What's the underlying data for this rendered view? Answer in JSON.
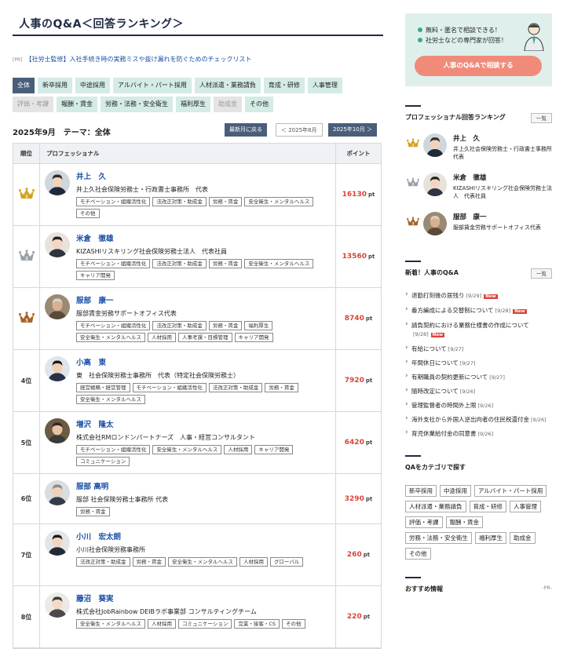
{
  "page": {
    "title": "人事のQ&A＜回答ランキング＞",
    "pr_tag": "[PR]",
    "pr_text": "【社労士監修】入社手続き時の実務ミスや抜け漏れを防ぐためのチェックリスト"
  },
  "categories": {
    "row1": [
      "全体",
      "新卒採用",
      "中途採用",
      "アルバイト・パート採用",
      "人材派遣・業務請負",
      "育成・研修",
      "人事管理"
    ],
    "row2": [
      "評価・考課",
      "報酬・賃金",
      "労務・法務・安全衛生",
      "福利厚生",
      "助成金",
      "その他"
    ]
  },
  "period": {
    "title": "2025年9月　テーマ：全体",
    "latest_label": "最新月に戻る",
    "prev_label": "＜ 2025年8月",
    "next_label": "2025年10月 ＞"
  },
  "table": {
    "col_rank": "順位",
    "col_pro": "プロフェッショナル",
    "col_points": "ポイント",
    "unit": "pt",
    "rows": [
      {
        "rank": "",
        "name": "井上　久",
        "org": "井上久社会保険労務士・行政書士事務所　代表",
        "tags": [
          "モチベーション・組織活性化",
          "法改正対策・助成金",
          "労務・賃金",
          "安全衛生・メンタルヘルス",
          "その他"
        ],
        "points": "16130"
      },
      {
        "rank": "",
        "name": "米倉　徹雄",
        "org": "KIZASHIリスキリング社会保険労務士法人　代表社員",
        "tags": [
          "モチベーション・組織活性化",
          "法改正対策・助成金",
          "労務・賃金",
          "安全衛生・メンタルヘルス",
          "キャリア開発"
        ],
        "points": "13560"
      },
      {
        "rank": "",
        "name": "服部　康一",
        "org": "服部賃金労務サポートオフィス代表",
        "tags": [
          "モチベーション・組織活性化",
          "法改正対策・助成金",
          "労務・賃金",
          "福利厚生",
          "安全衛生・メンタルヘルス",
          "人材採用",
          "人事考課・目標管理",
          "キャリア開発"
        ],
        "points": "8740"
      },
      {
        "rank": "4位",
        "name": "小高　東",
        "org": "東　社会保険労務士事務所　代表（特定社会保険労務士）",
        "tags": [
          "経営戦略・経営管理",
          "モチベーション・組織活性化",
          "法改正対策・助成金",
          "労務・賃金",
          "安全衛生・メンタルヘルス"
        ],
        "points": "7920"
      },
      {
        "rank": "5位",
        "name": "増沢　隆太",
        "org": "株式会社RMロンドンパートナーズ　人事・経営コンサルタント",
        "tags": [
          "モチベーション・組織活性化",
          "安全衛生・メンタルヘルス",
          "人材採用",
          "キャリア開発",
          "コミュニケーション"
        ],
        "points": "6420"
      },
      {
        "rank": "6位",
        "name": "服部 高明",
        "org": "服部 社会保険労務士事務所 代表",
        "tags": [
          "労務・賃金"
        ],
        "points": "3290"
      },
      {
        "rank": "7位",
        "name": "小川　宏太朗",
        "org": "小川社会保険労務事務所",
        "tags": [
          "法改正対策・助成金",
          "労務・賃金",
          "安全衛生・メンタルヘルス",
          "人材採用",
          "グローバル"
        ],
        "points": "260"
      },
      {
        "rank": "8位",
        "name": "藤沼　葵実",
        "org": "株式会社JobRainbow DEIBラボ事業部 コンサルティングチーム",
        "tags": [
          "安全衛生・メンタルヘルス",
          "人材採用",
          "コミュニケーション",
          "営業・接客・CS",
          "その他"
        ],
        "points": "220"
      }
    ]
  },
  "sidebar": {
    "consult": {
      "item1": "無料・匿名で相談できる！",
      "item2": "社労士などの専門家が回答！",
      "button": "人事のQ&Aで相談する"
    },
    "ranking": {
      "title": "プロフェッショナル回答ランキング",
      "more": "一覧",
      "items": [
        {
          "name": "井上　久",
          "org": "井上久社会保険労務士・行政書士事務所　代表"
        },
        {
          "name": "米倉　徹雄",
          "org": "KIZASHIリスキリング社会保険労務士法人　代表社員"
        },
        {
          "name": "服部　康一",
          "org": "服部賃金労務サポートオフィス代表"
        }
      ]
    },
    "news": {
      "title": "新着！人事のQ&A",
      "more": "一覧",
      "new_label": "New",
      "items": [
        {
          "text": "退勤打刻後の居残り",
          "date": "[9/29]",
          "new": true
        },
        {
          "text": "番方編成による交替制について",
          "date": "[9/28]",
          "new": true
        },
        {
          "text": "請負契約における業務仕様書の作成について",
          "date": "[9/28]",
          "new": true
        },
        {
          "text": "有給について",
          "date": "[9/27]",
          "new": false
        },
        {
          "text": "年間休日について",
          "date": "[9/27]",
          "new": false
        },
        {
          "text": "有期職員の契約更新について",
          "date": "[9/27]",
          "new": false
        },
        {
          "text": "随時改定について",
          "date": "[9/26]",
          "new": false
        },
        {
          "text": "管理監督者の時間外上限",
          "date": "[9/26]",
          "new": false
        },
        {
          "text": "海外支社から外国人逆出向者の住民税還付金",
          "date": "[9/26]",
          "new": false
        },
        {
          "text": "育児休業給付金の同意書",
          "date": "[9/26]",
          "new": false
        }
      ]
    },
    "qa_categories": {
      "title": "QAをカテゴリで探す",
      "items": [
        "新卒採用",
        "中途採用",
        "アルバイト・パート採用",
        "人材派遣・業務請負",
        "育成・研修",
        "人事管理",
        "評価・考課",
        "報酬・賃金",
        "労務・法務・安全衛生",
        "福利厚生",
        "助成金",
        "その他"
      ]
    },
    "recommend": {
      "title": "おすすめ情報",
      "pr": "-PR-"
    }
  },
  "colors": {
    "accent_navy": "#4a5e7a",
    "category_bg": "#d4ebe6",
    "points_red": "#d9443a",
    "name_blue": "#1a4fa8",
    "consult_button": "#f08b7a",
    "gold": "#d6a21e",
    "silver": "#9aa0a8",
    "bronze": "#a8642a"
  }
}
